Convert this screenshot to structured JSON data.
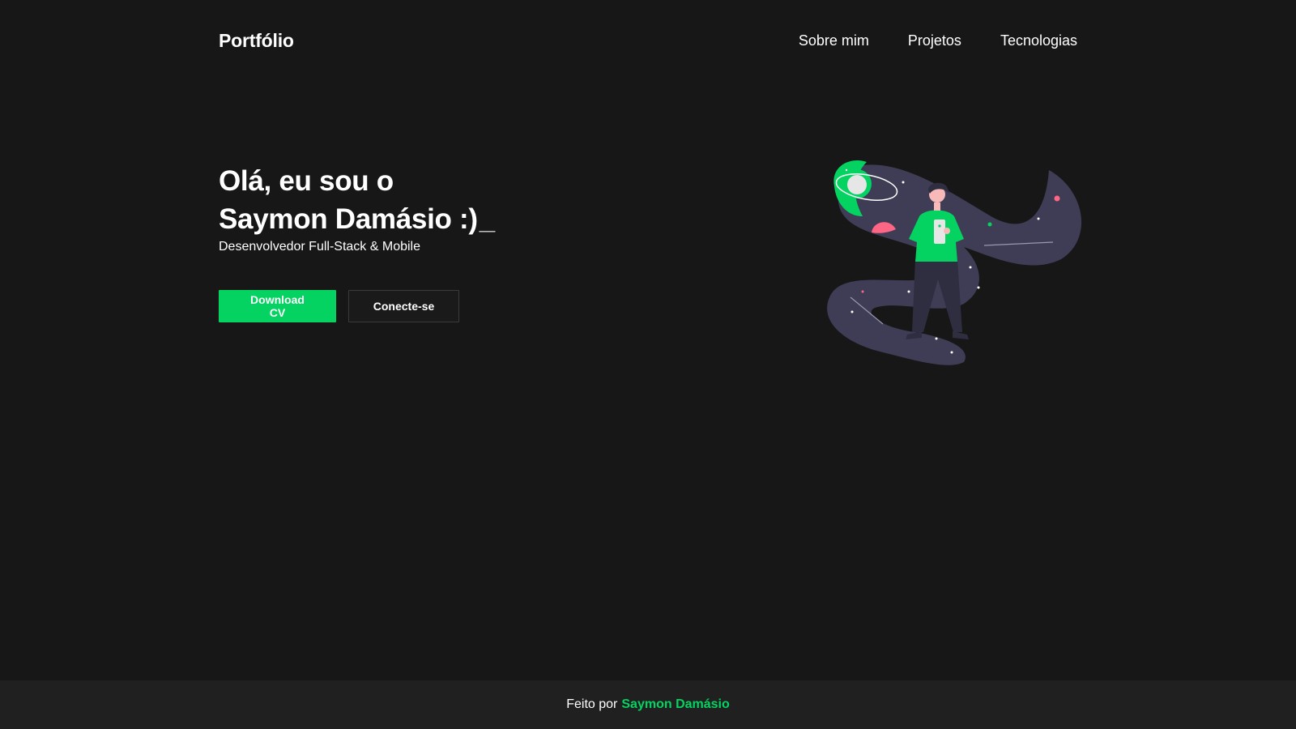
{
  "header": {
    "logo": "Portfólio",
    "nav": [
      {
        "label": "Sobre mim"
      },
      {
        "label": "Projetos"
      },
      {
        "label": "Tecnologias"
      }
    ]
  },
  "hero": {
    "title_line1": "Olá, eu sou o",
    "title_line2": "Saymon Damásio :)",
    "cursor": "_",
    "subtitle": "Desenvolvedor Full-Stack & Mobile",
    "primary_button": "Download CV",
    "secondary_button": "Conecte-se",
    "illustration_icon": "astronaut-space-illustration"
  },
  "footer": {
    "prefix": "Feito por",
    "author": "Saymon Damásio"
  },
  "colors": {
    "background": "#171717",
    "footer_background": "#202020",
    "accent": "#04d361",
    "text": "#ffffff",
    "illustration_purple": "#3f3d56",
    "illustration_pink": "#ff6584"
  }
}
